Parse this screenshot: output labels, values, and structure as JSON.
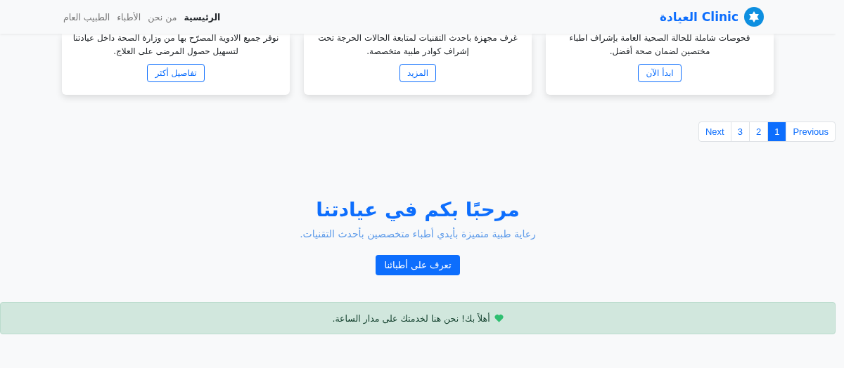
{
  "navbar": {
    "brand": "Clinic العيادة",
    "links": [
      {
        "label": "الرئيسية",
        "selected": true
      },
      {
        "label": "من نحن",
        "selected": false
      },
      {
        "label": "الأطباء",
        "selected": false
      },
      {
        "label": "الطبيب العام",
        "selected": false
      }
    ]
  },
  "cards": [
    {
      "text": "فحوصات شاملة للحالة الصحية العامة بإشراف اطباء مختصين لضمان صحة أفضل.",
      "button": "ابدأ الآن"
    },
    {
      "text": "غرف مجهزة باحدث التقنيات لمتابعة الحالات الحرجة تحت إشراف كوادر طبية متخصصة.",
      "button": "المزيد"
    },
    {
      "text": "نوفر جميع الادوية المصرّح بها من وزارة الصحة داخل عيادتنا لتسهيل حصول المرضى على العلاج.",
      "button": "تفاصيل أكثر"
    }
  ],
  "pagination": [
    {
      "label": "Previous",
      "selected": false
    },
    {
      "label": "1",
      "selected": true
    },
    {
      "label": "2",
      "selected": false
    },
    {
      "label": "3",
      "selected": false
    },
    {
      "label": "Next",
      "selected": false
    }
  ],
  "hero": {
    "title": "مرحبًا بكم في عيادتنا",
    "subtitle": "رعاية طبية متميزة بأيدي أطباء متخصصين بأحدث التقنيات.",
    "button": "تعرف على أطبائنا"
  },
  "alert": {
    "text": "أهلاً بك! نحن هنا لخدمتك على مدار الساعة."
  }
}
